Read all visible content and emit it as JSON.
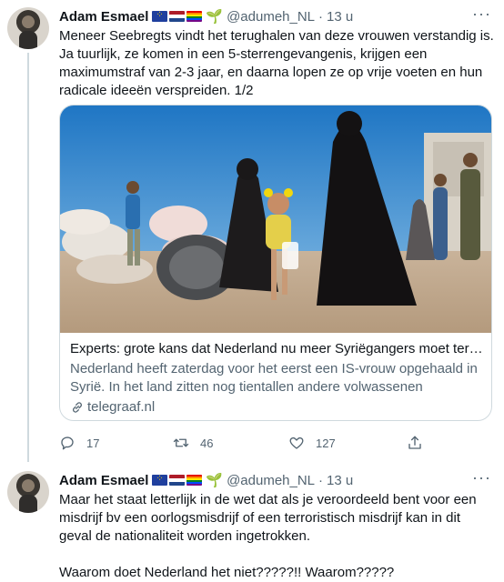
{
  "tweets": [
    {
      "author": {
        "name": "Adam Esmael",
        "flags": [
          "eu-flag",
          "nl-flag",
          "rainbow-flag"
        ],
        "emoji": "seedling",
        "handle": "@adumeh_NL",
        "separator": "·",
        "time": "13 u"
      },
      "text": "Meneer Seebregts vindt het terughalen van deze vrouwen verstandig is. Ja tuurlijk, ze komen in een 5-sterrengevangenis, krijgen een maximumstraf van 2-3 jaar, en daarna lopen ze op vrije voeten en hun radicale ideeën verspreiden. 1/2",
      "card": {
        "title": "Experts: grote kans dat Nederland nu meer Syriëgangers moet terugha...",
        "description": "Nederland heeft zaterdag voor het eerst een IS-vrouw opgehaald in Syrië. In het land zitten nog tientallen andere volwassenen gevangen i...",
        "domain": "telegraaf.nl"
      },
      "actions": {
        "replies": "17",
        "retweets": "46",
        "likes": "127"
      }
    },
    {
      "author": {
        "name": "Adam Esmael",
        "flags": [
          "eu-flag",
          "nl-flag",
          "rainbow-flag"
        ],
        "emoji": "seedling",
        "handle": "@adumeh_NL",
        "separator": "·",
        "time": "13 u"
      },
      "text": "Maar het staat letterlijk in de wet dat als je veroordeeld bent voor een misdrijf bv een oorlogsmisdrijf of een terroristisch misdrijf kan in dit geval de nationaliteit worden ingetrokken.\n\nWaarom doet Nederland het niet?????!! Waarom?????"
    }
  ],
  "colors": {
    "text": "#0f1419",
    "secondary": "#536471",
    "border": "#cfd9de"
  }
}
